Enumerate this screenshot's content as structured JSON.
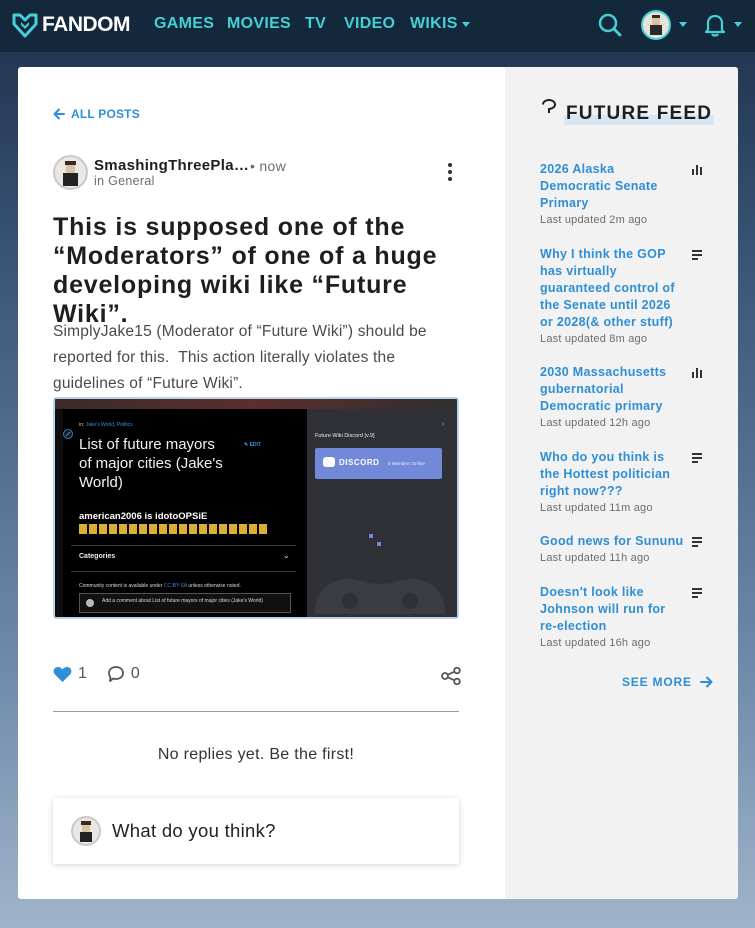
{
  "nav": {
    "logo_text": "FANDOM",
    "items": [
      "GAMES",
      "MOVIES",
      "TV",
      "VIDEO",
      "WIKIS"
    ]
  },
  "post": {
    "back_label": "ALL POSTS",
    "author": "SmashingThreePlatypus",
    "time": "• now",
    "category": "in General",
    "title": "This is supposed one of the “Moderators” of one of a huge developing wiki like “Future Wiki”.",
    "body": "SimplyJake15 (Moderator of “Future Wiki”) should be reported for this.  This action literally violates the guidelines of “Future Wiki”.",
    "likes": "1",
    "replies": "0",
    "no_replies": "No replies yet. Be the first!",
    "reply_placeholder": "What do you think?"
  },
  "embed": {
    "tag_prefix": "in:",
    "tag_links": "Jake's World, Politics",
    "title": "List of future mayors of major cities (Jake's World)",
    "edit_label": "EDIT",
    "comment": "american2006 is idotoOPSiE",
    "categories": "Categories",
    "license_prefix": "Community content is available under",
    "license_link": "CC-BY-SA",
    "license_suffix": "unless otherwise noted.",
    "comment_input": "Add a comment about List of future mayors of major cities (Jake's World)",
    "right_title": "Future Wiki Discord [v.9]",
    "discord_label": "DISCORD",
    "discord_online": "0 Members Online"
  },
  "feed": {
    "title": "FUTURE FEED",
    "items": [
      {
        "title": "2026 Alaska Democratic Senate Primary",
        "meta": "Last updated 2m ago",
        "type": "poll-icon"
      },
      {
        "title": "Why I think the GOP has virtually guaranteed control of the Senate until 2026 or 2028(& other stuff)",
        "meta": "Last updated 8m ago",
        "type": "text-post-icon"
      },
      {
        "title": "2030 Massachusetts gubernatorial Democratic primary",
        "meta": "Last updated 12h ago",
        "type": "poll-icon"
      },
      {
        "title": "Who do you think is the Hottest politician right now???",
        "meta": "Last updated 11m ago",
        "type": "text-post-icon"
      },
      {
        "title": "Good news for Sununu",
        "meta": "Last updated 11h ago",
        "type": "text-post-icon"
      },
      {
        "title": "Doesn't look like Johnson will run for re-election",
        "meta": "Last updated 16h ago",
        "type": "text-post-icon"
      }
    ],
    "see_more": "SEE MORE"
  },
  "colors": {
    "accent": "#44d0d6",
    "link": "#2e8fd6",
    "nav_bg": "#14283c",
    "heart": "#2e8fd6"
  }
}
